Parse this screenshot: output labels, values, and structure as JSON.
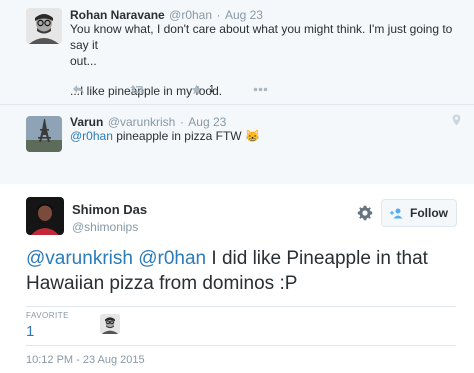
{
  "tweets": [
    {
      "name": "Rohan Naravane",
      "handle": "@r0han",
      "separator": "·",
      "date": "Aug 23",
      "text_line1": "You know what, I don't care about what you might think. I'm just going to say it",
      "text_line2": "out...",
      "text_line3": "...I like pineapple in my food.",
      "favorite_count": "1",
      "avatar_icon": "person-glasses-avatar"
    },
    {
      "name": "Varun",
      "handle": "@varunkrish",
      "separator": "·",
      "date": "Aug 23",
      "mention": "@r0han",
      "text": " pineapple in pizza FTW ",
      "emoji": "😸",
      "avatar_icon": "eiffel-tower-avatar"
    }
  ],
  "main_tweet": {
    "name": "Shimon Das",
    "handle": "@shimonips",
    "follow_label": "Follow",
    "mention1": "@varunkrish",
    "mention2": "@r0han",
    "text": " I did like Pineapple in that Hawaiian pizza from dominos :P",
    "favorite_label": "FAVORITE",
    "favorite_count": "1",
    "timestamp": "10:12 PM - 23 Aug 2015"
  },
  "colors": {
    "link": "#2b7bb9",
    "muted": "#8899a6",
    "icon": "#aab8c2",
    "thread_bg": "#f5f8fa",
    "follow_blue": "#55acee"
  }
}
